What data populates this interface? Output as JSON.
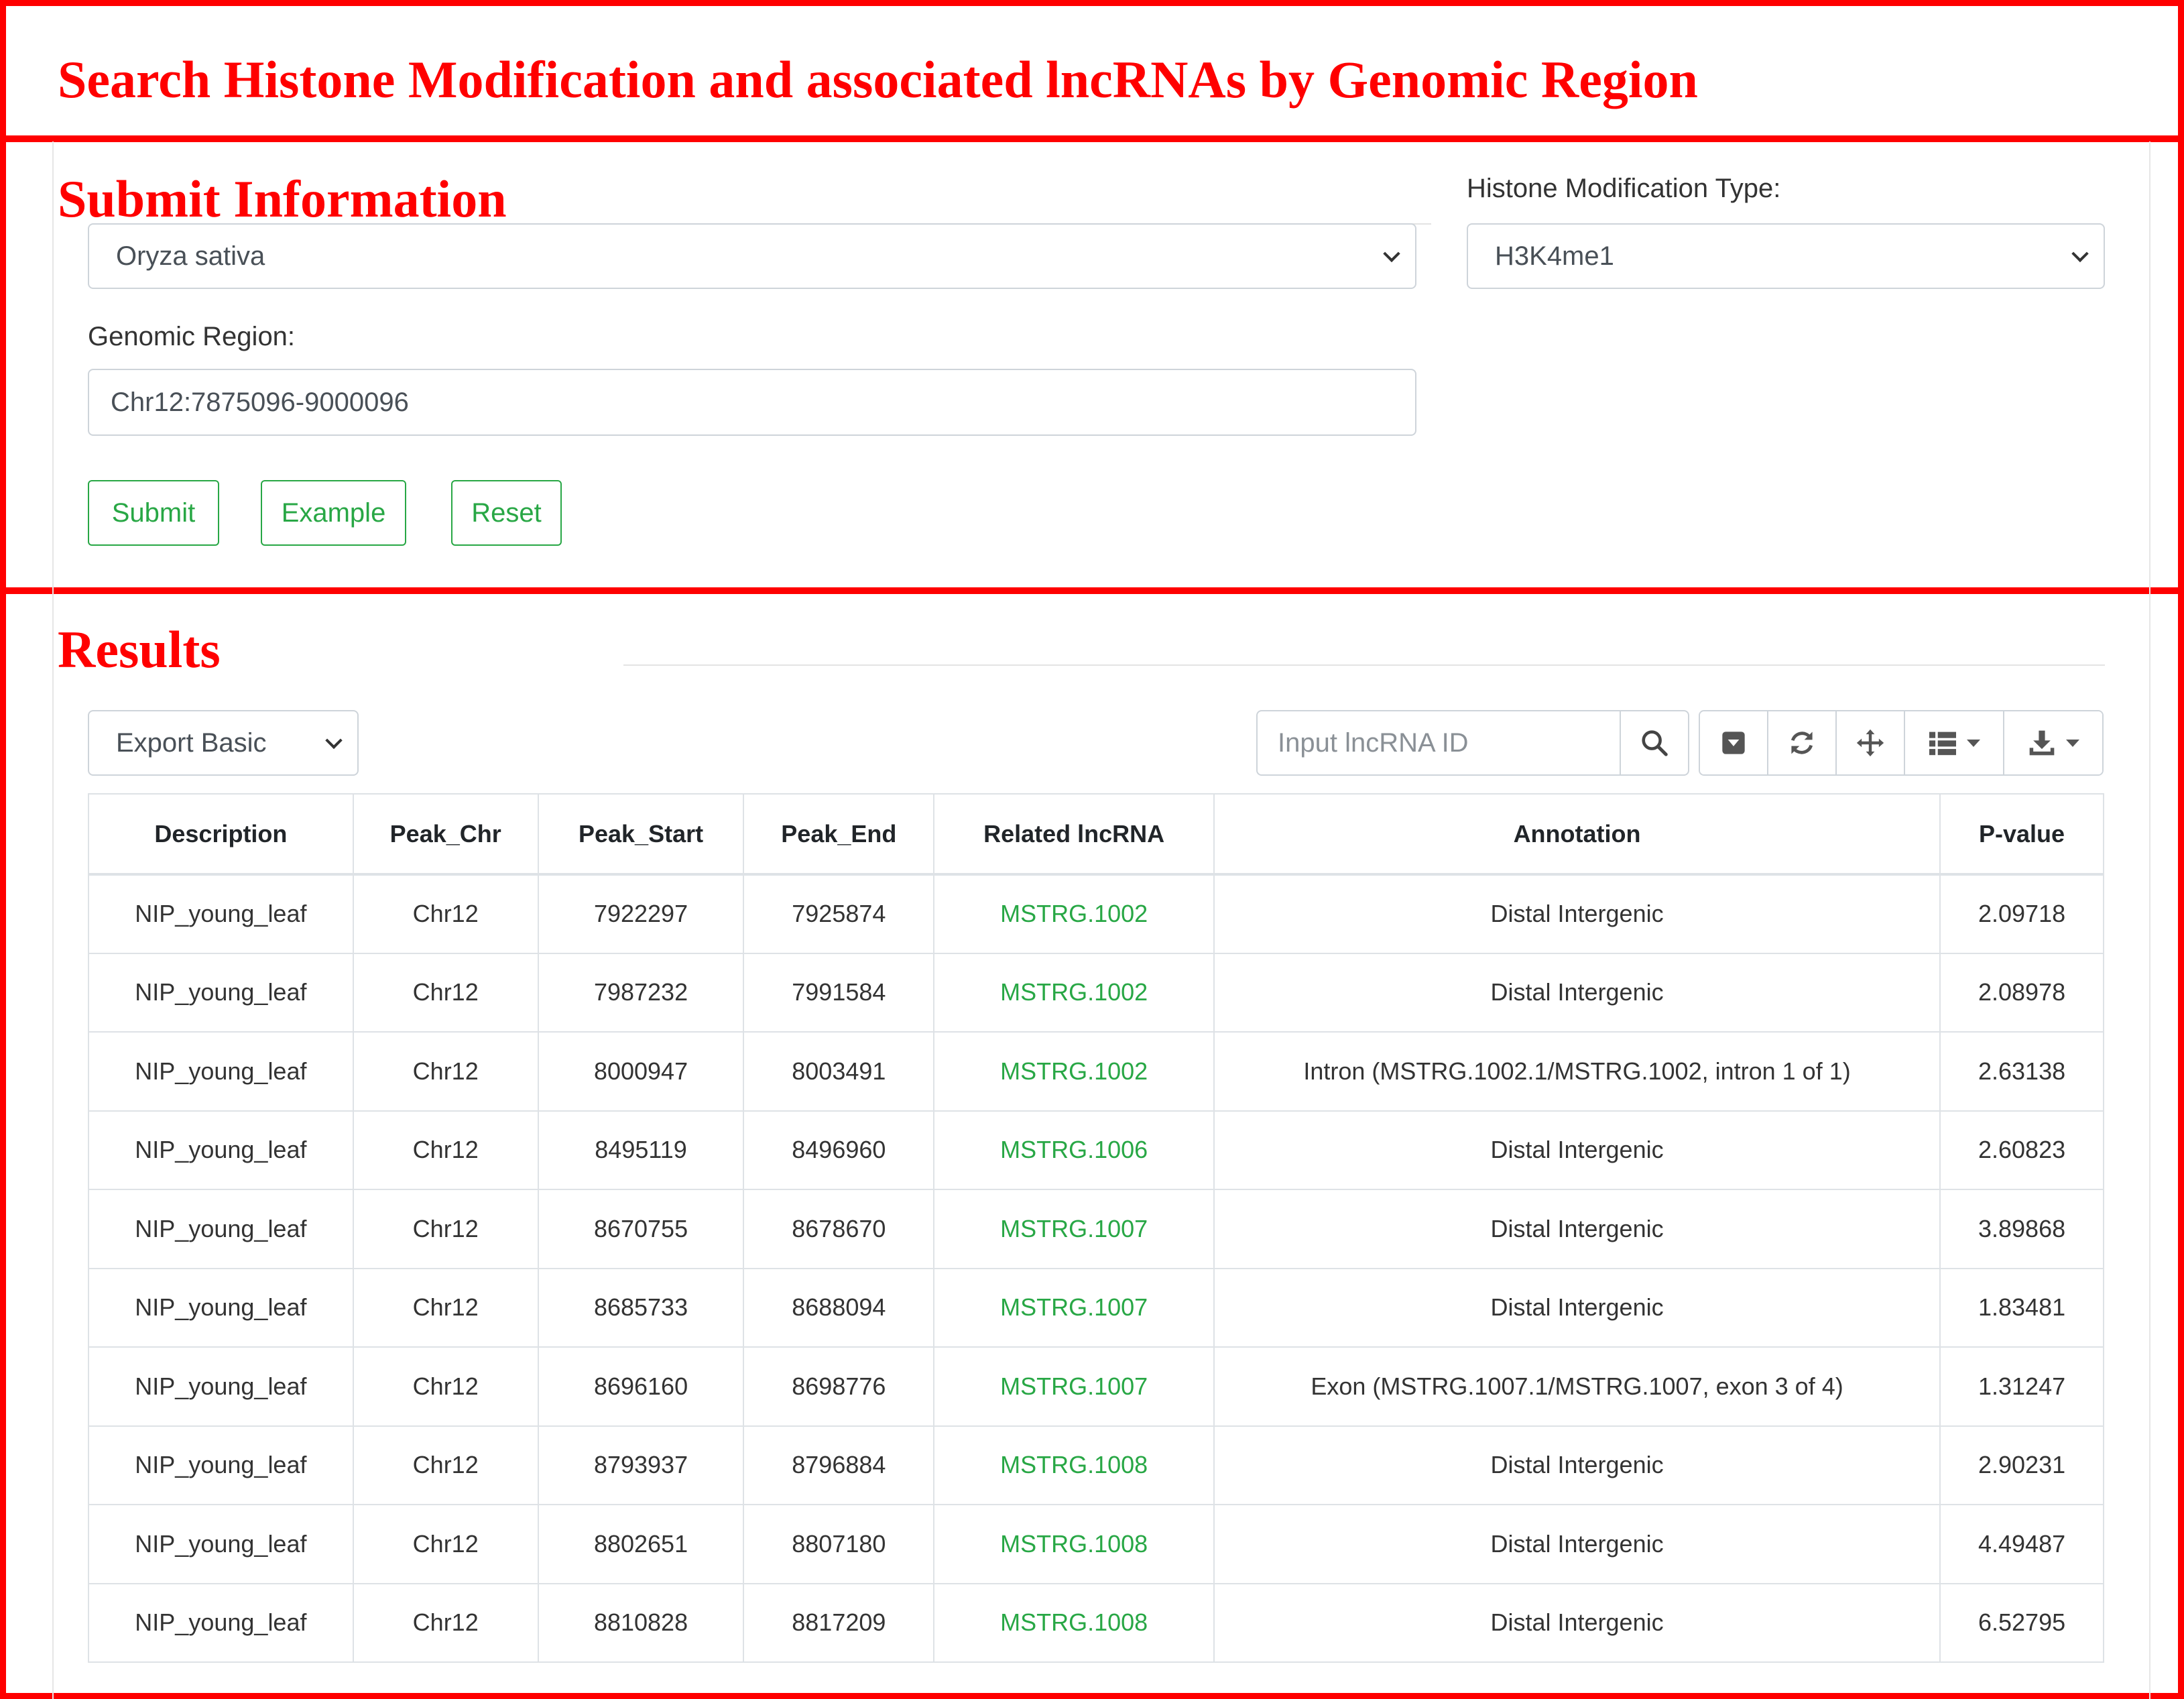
{
  "annotations": {
    "title": "Search Histone Modification and associated lncRNAs by Genomic Region",
    "submit": "Submit Information",
    "results": "Results"
  },
  "form": {
    "species_value": "Oryza sativa",
    "histone_label": "Histone Modification Type:",
    "histone_value": "H3K4me1",
    "region_label": "Genomic Region:",
    "region_value": "Chr12:7875096-9000096",
    "submit_label": "Submit",
    "example_label": "Example",
    "reset_label": "Reset"
  },
  "results": {
    "export_value": "Export Basic",
    "search_placeholder": "Input lncRNA ID",
    "toolbar_icons": [
      "search-icon",
      "toggle-icon",
      "refresh-icon",
      "move-icon",
      "columns-icon",
      "download-icon"
    ],
    "columns": [
      "Description",
      "Peak_Chr",
      "Peak_Start",
      "Peak_End",
      "Related lncRNA",
      "Annotation",
      "P-value"
    ],
    "rows": [
      [
        "NIP_young_leaf",
        "Chr12",
        "7922297",
        "7925874",
        "MSTRG.1002",
        "Distal Intergenic",
        "2.09718"
      ],
      [
        "NIP_young_leaf",
        "Chr12",
        "7987232",
        "7991584",
        "MSTRG.1002",
        "Distal Intergenic",
        "2.08978"
      ],
      [
        "NIP_young_leaf",
        "Chr12",
        "8000947",
        "8003491",
        "MSTRG.1002",
        "Intron (MSTRG.1002.1/MSTRG.1002, intron 1 of 1)",
        "2.63138"
      ],
      [
        "NIP_young_leaf",
        "Chr12",
        "8495119",
        "8496960",
        "MSTRG.1006",
        "Distal Intergenic",
        "2.60823"
      ],
      [
        "NIP_young_leaf",
        "Chr12",
        "8670755",
        "8678670",
        "MSTRG.1007",
        "Distal Intergenic",
        "3.89868"
      ],
      [
        "NIP_young_leaf",
        "Chr12",
        "8685733",
        "8688094",
        "MSTRG.1007",
        "Distal Intergenic",
        "1.83481"
      ],
      [
        "NIP_young_leaf",
        "Chr12",
        "8696160",
        "8698776",
        "MSTRG.1007",
        "Exon (MSTRG.1007.1/MSTRG.1007, exon 3 of 4)",
        "1.31247"
      ],
      [
        "NIP_young_leaf",
        "Chr12",
        "8793937",
        "8796884",
        "MSTRG.1008",
        "Distal Intergenic",
        "2.90231"
      ],
      [
        "NIP_young_leaf",
        "Chr12",
        "8802651",
        "8807180",
        "MSTRG.1008",
        "Distal Intergenic",
        "4.49487"
      ],
      [
        "NIP_young_leaf",
        "Chr12",
        "8810828",
        "8817209",
        "MSTRG.1008",
        "Distal Intergenic",
        "6.52795"
      ]
    ]
  },
  "colors": {
    "annotation": "#ff0000",
    "accent_green": "#28a745",
    "border_gray": "#dee2e6"
  }
}
